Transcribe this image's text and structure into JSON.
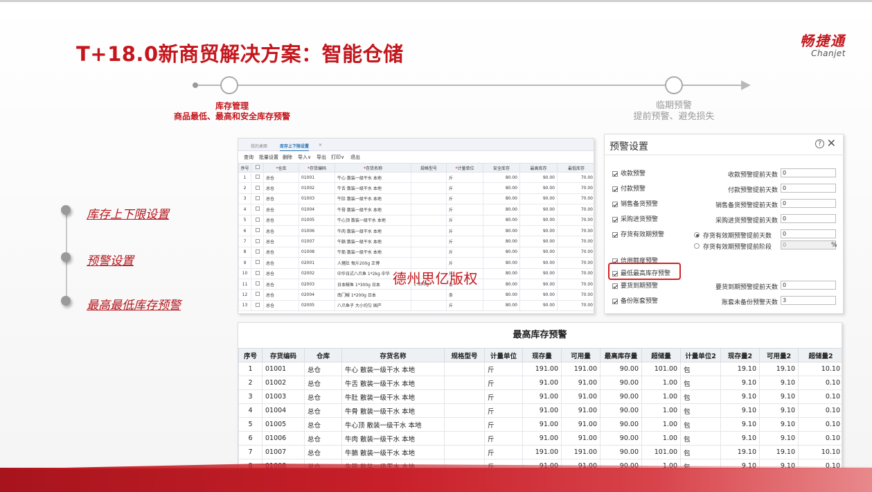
{
  "title": "T+18.0新商贸解决方案：智能仓储",
  "logo": {
    "cn": "畅捷通",
    "en": "Chanjet"
  },
  "timeline": {
    "left": {
      "line1": "库存管理",
      "line2": "商品最低、最高和安全库存预警"
    },
    "right": {
      "line1": "临期预警",
      "line2": "提前预警、避免损失"
    }
  },
  "features": [
    "库存上下限设置",
    "预警设置",
    "最高最低库存预警"
  ],
  "watermark": "德州思亿版权",
  "small_table": {
    "tabs": [
      "我的桌面",
      "库存上下限设置"
    ],
    "toolbar": [
      "查询",
      "批量设置",
      "删除",
      "导入∨",
      "导出",
      "打印∨",
      "退出"
    ],
    "headers": [
      "序号",
      "",
      "*仓库",
      "*存货编码",
      "*存货名称",
      "规格型号",
      "*计量单位",
      "安全库存",
      "最高库存",
      "最低库存"
    ],
    "rows": [
      [
        "1",
        "总仓",
        "01001",
        "牛心 散装一级干水 本地",
        "",
        "斤",
        "80.00",
        "90.00",
        "70.00"
      ],
      [
        "2",
        "总仓",
        "01002",
        "牛舌 散装一级干水 本地",
        "",
        "斤",
        "80.00",
        "90.00",
        "70.00"
      ],
      [
        "3",
        "总仓",
        "01003",
        "牛肚 散装一级干水 本地",
        "",
        "斤",
        "80.00",
        "90.00",
        "70.00"
      ],
      [
        "4",
        "总仓",
        "01004",
        "牛骨 散装一级干水 本地",
        "",
        "斤",
        "80.00",
        "90.00",
        "70.00"
      ],
      [
        "5",
        "总仓",
        "01005",
        "牛心顶 散装一级干水 本地",
        "",
        "斤",
        "80.00",
        "90.00",
        "70.00"
      ],
      [
        "6",
        "总仓",
        "01006",
        "牛肉 散装一级干水 本地",
        "",
        "斤",
        "80.00",
        "90.00",
        "70.00"
      ],
      [
        "7",
        "总仓",
        "01007",
        "牛腩 散装一级干水 本地",
        "",
        "斤",
        "80.00",
        "90.00",
        "70.00"
      ],
      [
        "8",
        "总仓",
        "01008",
        "牛筋 散装一级干水 本地",
        "",
        "斤",
        "80.00",
        "90.00",
        "70.00"
      ],
      [
        "9",
        "总仓",
        "02001",
        "人猪肚 每斤200g 正博",
        "",
        "斤",
        "80.00",
        "90.00",
        "70.00"
      ],
      [
        "10",
        "总仓",
        "02002",
        "中华日式八爪鱼 1*2kg 中华",
        "",
        "斤",
        "80.00",
        "90.00",
        "70.00"
      ],
      [
        "11",
        "总仓",
        "02003",
        "日本鳗鱼 1*300g 日本",
        "1*300g",
        "条",
        "80.00",
        "90.00",
        "70.00"
      ],
      [
        "12",
        "总仓",
        "02004",
        "南门鳗 1*200g 日本",
        "",
        "条",
        "80.00",
        "90.00",
        "70.00"
      ],
      [
        "13",
        "总仓",
        "02005",
        "八爪鱼子 大小均匀 国产",
        "",
        "斤",
        "80.00",
        "90.00",
        "70.00"
      ]
    ]
  },
  "settings": {
    "title": "预警设置",
    "help": "?",
    "close": "✕",
    "checks": [
      "收款预警",
      "付款预警",
      "销售备货预警",
      "采购进货预警",
      "存货有效期预警",
      "信用额度预警",
      "最低最高库存预警",
      "要货到期预警",
      "备份账套预警"
    ],
    "fields": [
      {
        "label": "收款预警提前天数",
        "value": "0"
      },
      {
        "label": "付款预警提前天数",
        "value": "0"
      },
      {
        "label": "销售备货预警提前天数",
        "value": "0"
      },
      {
        "label": "采购进货预警提前天数",
        "value": "0"
      },
      {
        "label": "存货有效期预警提前天数",
        "value": "0"
      },
      {
        "label": "存货有效期预警提前阶段",
        "value": "0"
      },
      {
        "label": "要货到期预警提前天数",
        "value": "0"
      },
      {
        "label": "账套未备份预警天数",
        "value": "3"
      }
    ],
    "percent": "%"
  },
  "big_table": {
    "title": "最高库存预警",
    "headers": [
      "序号",
      "存货编码",
      "仓库",
      "存货名称",
      "规格型号",
      "计量单位",
      "现存量",
      "可用量",
      "最高库存量",
      "超储量",
      "计量单位2",
      "现存量2",
      "可用量2",
      "超储量2"
    ],
    "rows": [
      [
        "1",
        "01001",
        "总仓",
        "牛心 散装一级干水 本地",
        "",
        "斤",
        "191.00",
        "191.00",
        "90.00",
        "101.00",
        "包",
        "19.10",
        "19.10",
        "10.10"
      ],
      [
        "2",
        "01002",
        "总仓",
        "牛舌 散装一级干水 本地",
        "",
        "斤",
        "91.00",
        "91.00",
        "90.00",
        "1.00",
        "包",
        "9.10",
        "9.10",
        "0.10"
      ],
      [
        "3",
        "01003",
        "总仓",
        "牛肚 散装一级干水 本地",
        "",
        "斤",
        "91.00",
        "91.00",
        "90.00",
        "1.00",
        "包",
        "9.10",
        "9.10",
        "0.10"
      ],
      [
        "4",
        "01004",
        "总仓",
        "牛骨 散装一级干水 本地",
        "",
        "斤",
        "91.00",
        "91.00",
        "90.00",
        "1.00",
        "包",
        "9.10",
        "9.10",
        "0.10"
      ],
      [
        "5",
        "01005",
        "总仓",
        "牛心顶 散装一级干水 本地",
        "",
        "斤",
        "91.00",
        "91.00",
        "90.00",
        "1.00",
        "包",
        "9.10",
        "9.10",
        "0.10"
      ],
      [
        "6",
        "01006",
        "总仓",
        "牛肉 散装一级干水 本地",
        "",
        "斤",
        "91.00",
        "91.00",
        "90.00",
        "1.00",
        "包",
        "9.10",
        "9.10",
        "0.10"
      ],
      [
        "7",
        "01007",
        "总仓",
        "牛腩 散装一级干水 本地",
        "",
        "斤",
        "191.00",
        "191.00",
        "90.00",
        "101.00",
        "包",
        "19.10",
        "19.10",
        "10.10"
      ],
      [
        "8",
        "01008",
        "总仓",
        "牛筋 散装一级干水 本地",
        "",
        "斤",
        "91.00",
        "91.00",
        "90.00",
        "1.00",
        "包",
        "9.10",
        "9.10",
        "0.10"
      ]
    ]
  }
}
